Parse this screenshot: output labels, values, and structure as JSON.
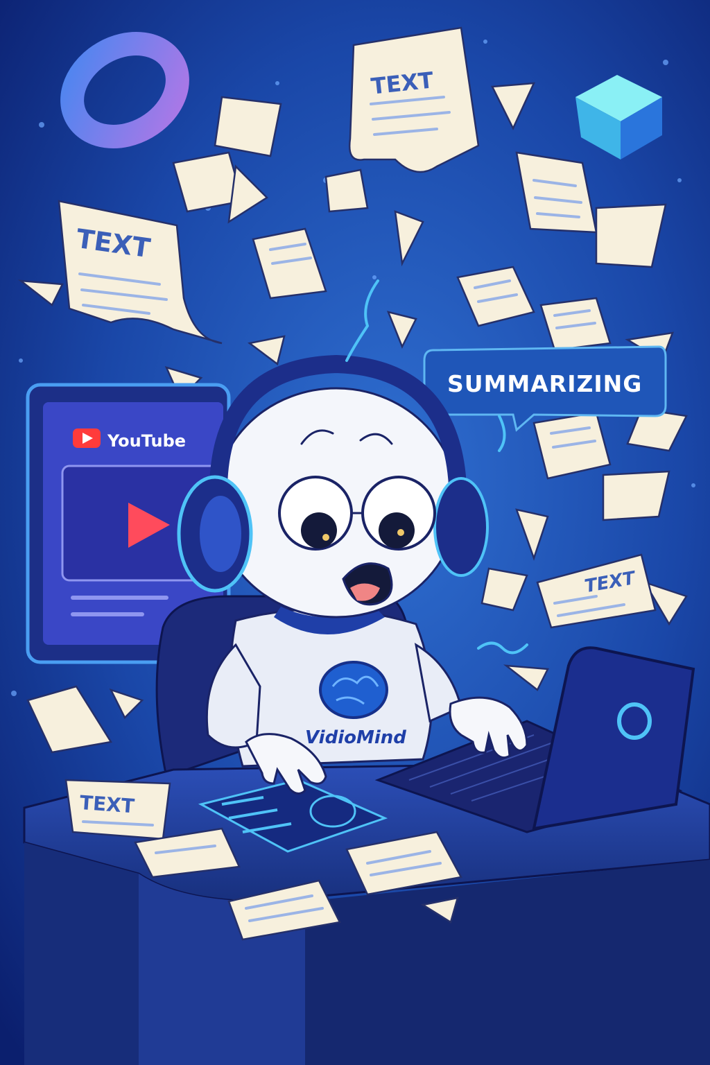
{
  "labels": {
    "text_word": "TEXT",
    "bubble": "SUMMARIZING",
    "screen_brand": "YouTube",
    "shirt_brand": "VidioMind"
  },
  "colors": {
    "background_top": "#0b1f6e",
    "background_mid": "#1d4fb0",
    "paper": "#f7f0dd",
    "outline": "#1a2366",
    "youtube_red": "#ff3b3b",
    "accent_cyan": "#4fc3f7"
  },
  "icons": {
    "play": "youtube-play-icon",
    "brain": "brain-logo-icon"
  }
}
